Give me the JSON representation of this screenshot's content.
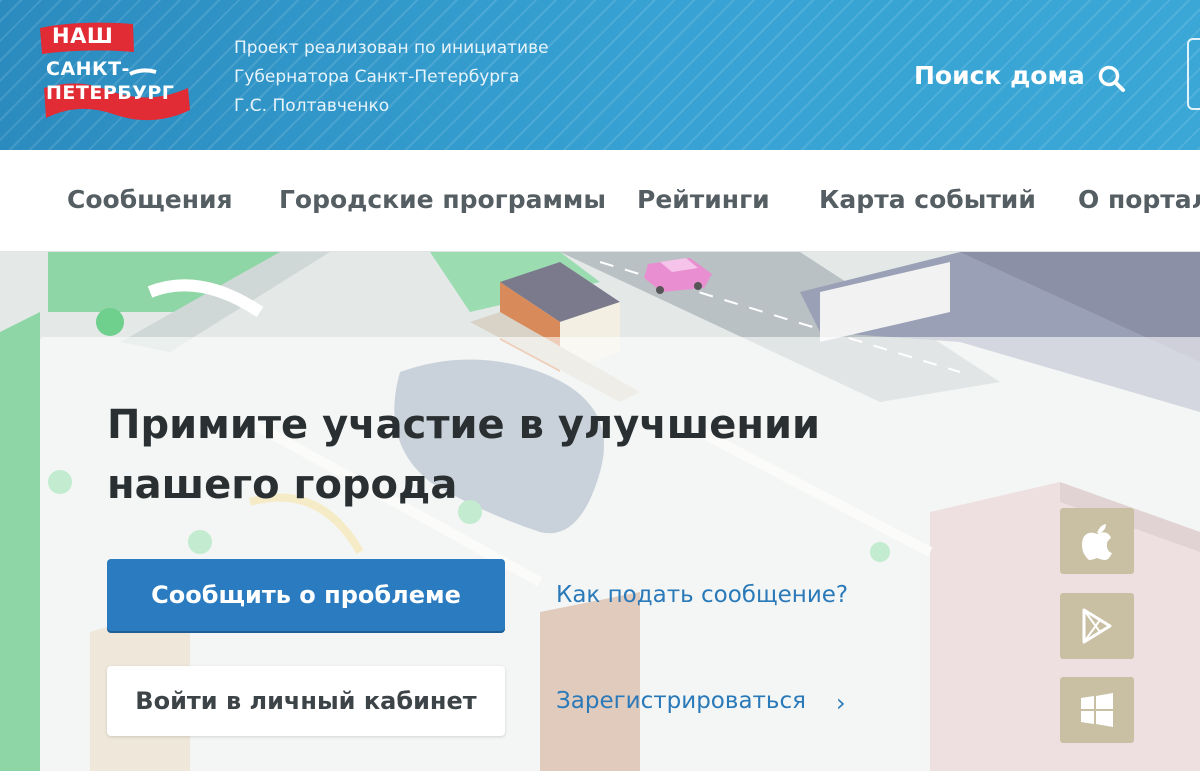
{
  "header": {
    "logo": {
      "line1": "НАШ",
      "line2": "САНКТ-",
      "line3": "ПЕТЕРБУРГ"
    },
    "tagline": [
      "Проект реализован по инициативе",
      "Губернатора Санкт-Петербурга",
      "Г.С. Полтавченко"
    ],
    "search_label": "Поиск дома",
    "search_icon": "search-icon"
  },
  "nav": {
    "items": [
      {
        "label": "Сообщения"
      },
      {
        "label": "Городские программы"
      },
      {
        "label": "Рейтинги"
      },
      {
        "label": "Карта событий"
      },
      {
        "label": "О портал"
      }
    ]
  },
  "hero": {
    "title_line1": "Примите участие в улучшении",
    "title_line2": "нашего города",
    "report_button": "Сообщить о проблеме",
    "login_button": "Войти в личный кабинет",
    "howto_link": "Как подать сообщение?",
    "register_link": "Зарегистрироваться",
    "register_chevron": "›"
  },
  "app_stores": [
    {
      "icon": "apple-icon"
    },
    {
      "icon": "google-play-icon"
    },
    {
      "icon": "windows-icon"
    }
  ],
  "colors": {
    "header_blue": "#37a2d3",
    "primary_button": "#2a7bbf",
    "link": "#2a79b9",
    "logo_red": "#e12b35",
    "store_tile": "#c9c0a4"
  }
}
